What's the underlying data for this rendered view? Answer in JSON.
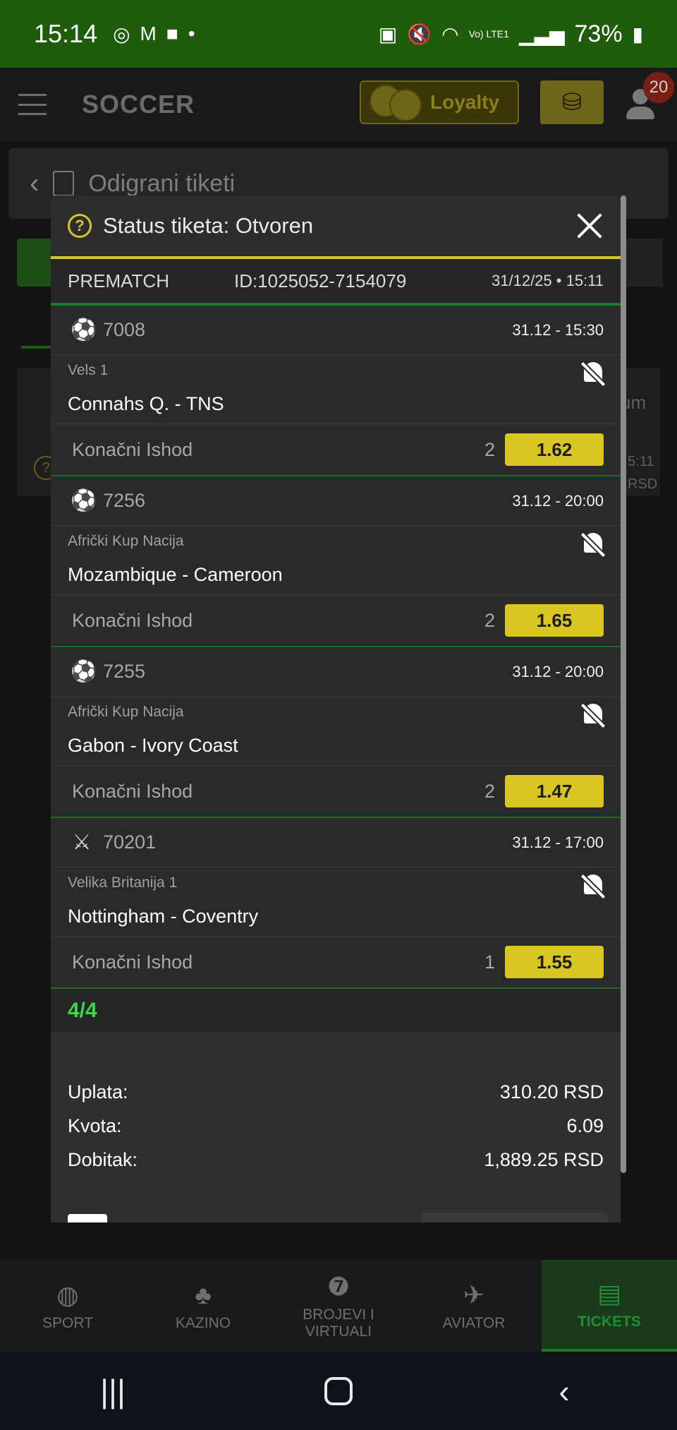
{
  "status_bar": {
    "time": "15:14",
    "battery": "73%",
    "network": "Vo) LTE1"
  },
  "header": {
    "logo": "SOCCER",
    "loyalty_label": "Loyalty",
    "notification_count": "20"
  },
  "page": {
    "title": "Odigrani tiketi",
    "bg_column": "um",
    "bg_time": "5:11",
    "bg_currency": "RSD"
  },
  "modal": {
    "title": "Status tiketa: Otvoren",
    "type": "PREMATCH",
    "ticket_id": "ID:1025052-7154079",
    "created": "31/12/25 • 15:11",
    "events": [
      {
        "sport_icon": "soccer-ball-icon",
        "code": "7008",
        "datetime": "31.12  -  15:30",
        "league": "Vels 1",
        "match": "Connahs Q. - TNS",
        "market": "Konačni Ishod",
        "pick": "2",
        "odd": "1.62"
      },
      {
        "sport_icon": "soccer-ball-icon",
        "code": "7256",
        "datetime": "31.12  -  20:00",
        "league": "Afrički Kup Nacija",
        "match": "Mozambique - Cameroon",
        "market": "Konačni Ishod",
        "pick": "2",
        "odd": "1.65"
      },
      {
        "sport_icon": "soccer-ball-icon",
        "code": "7255",
        "datetime": "31.12  -  20:00",
        "league": "Afrički Kup Nacija",
        "match": "Gabon - Ivory Coast",
        "market": "Konačni Ishod",
        "pick": "2",
        "odd": "1.47"
      },
      {
        "sport_icon": "crossed-swords-icon",
        "code": "70201",
        "datetime": "31.12  -  17:00",
        "league": "Velika Britanija 1",
        "match": "Nottingham - Coventry",
        "market": "Konačni Ishod",
        "pick": "1",
        "odd": "1.55"
      }
    ],
    "count": "4/4",
    "summary": {
      "stake_label": "Uplata:",
      "stake_value": "310.20 RSD",
      "odds_label": "Kvota:",
      "odds_value": "6.09",
      "win_label": "Dobitak:",
      "win_value": "1,889.25 RSD"
    }
  },
  "bottom_nav": [
    {
      "label": "SPORT",
      "icon": "basketball-icon"
    },
    {
      "label": "KAZINO",
      "icon": "cherries-icon"
    },
    {
      "label": "BROJEVI I VIRTUALI",
      "icon": "lottery-ball-icon"
    },
    {
      "label": "AVIATOR",
      "icon": "airplane-icon"
    },
    {
      "label": "TICKETS",
      "icon": "ticket-icon",
      "active": true
    }
  ],
  "colors": {
    "accent_yellow": "#d9c623",
    "accent_green": "#1a7d2d",
    "count_green": "#3ed64d",
    "status_bar": "#1f5c0c"
  }
}
